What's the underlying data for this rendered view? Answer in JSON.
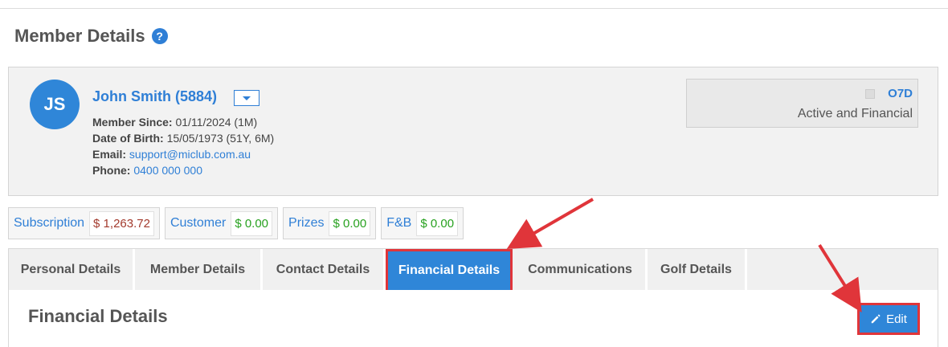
{
  "page": {
    "title": "Member Details"
  },
  "member": {
    "initials": "JS",
    "name": "John Smith (5884)",
    "member_since_label": "Member Since:",
    "member_since": "01/11/2024 (1M)",
    "dob_label": "Date of Birth:",
    "dob": "15/05/1973 (51Y, 6M)",
    "email_label": "Email:",
    "email": "support@miclub.com.au",
    "phone_label": "Phone:",
    "phone": "0400 000 000"
  },
  "status": {
    "code": "O7D",
    "text": "Active and Financial"
  },
  "balances": [
    {
      "label": "Subscription",
      "amount": "$ 1,263.72"
    },
    {
      "label": "Customer",
      "amount": "$ 0.00"
    },
    {
      "label": "Prizes",
      "amount": "$ 0.00"
    },
    {
      "label": "F&B",
      "amount": "$ 0.00"
    }
  ],
  "tabs": [
    {
      "label": "Personal Details"
    },
    {
      "label": "Member Details"
    },
    {
      "label": "Contact Details"
    },
    {
      "label": "Financial Details",
      "active": true
    },
    {
      "label": "Communications"
    },
    {
      "label": "Golf Details"
    }
  ],
  "section": {
    "title": "Financial Details",
    "edit_label": "Edit"
  },
  "colors": {
    "accent": "#2f86d8",
    "highlight": "#e0353a",
    "negative": "#a33a2d",
    "positive": "#27a11f"
  },
  "icons": {
    "help": "question-circle-icon",
    "dropdown": "caret-down-icon",
    "edit": "pencil-icon"
  }
}
